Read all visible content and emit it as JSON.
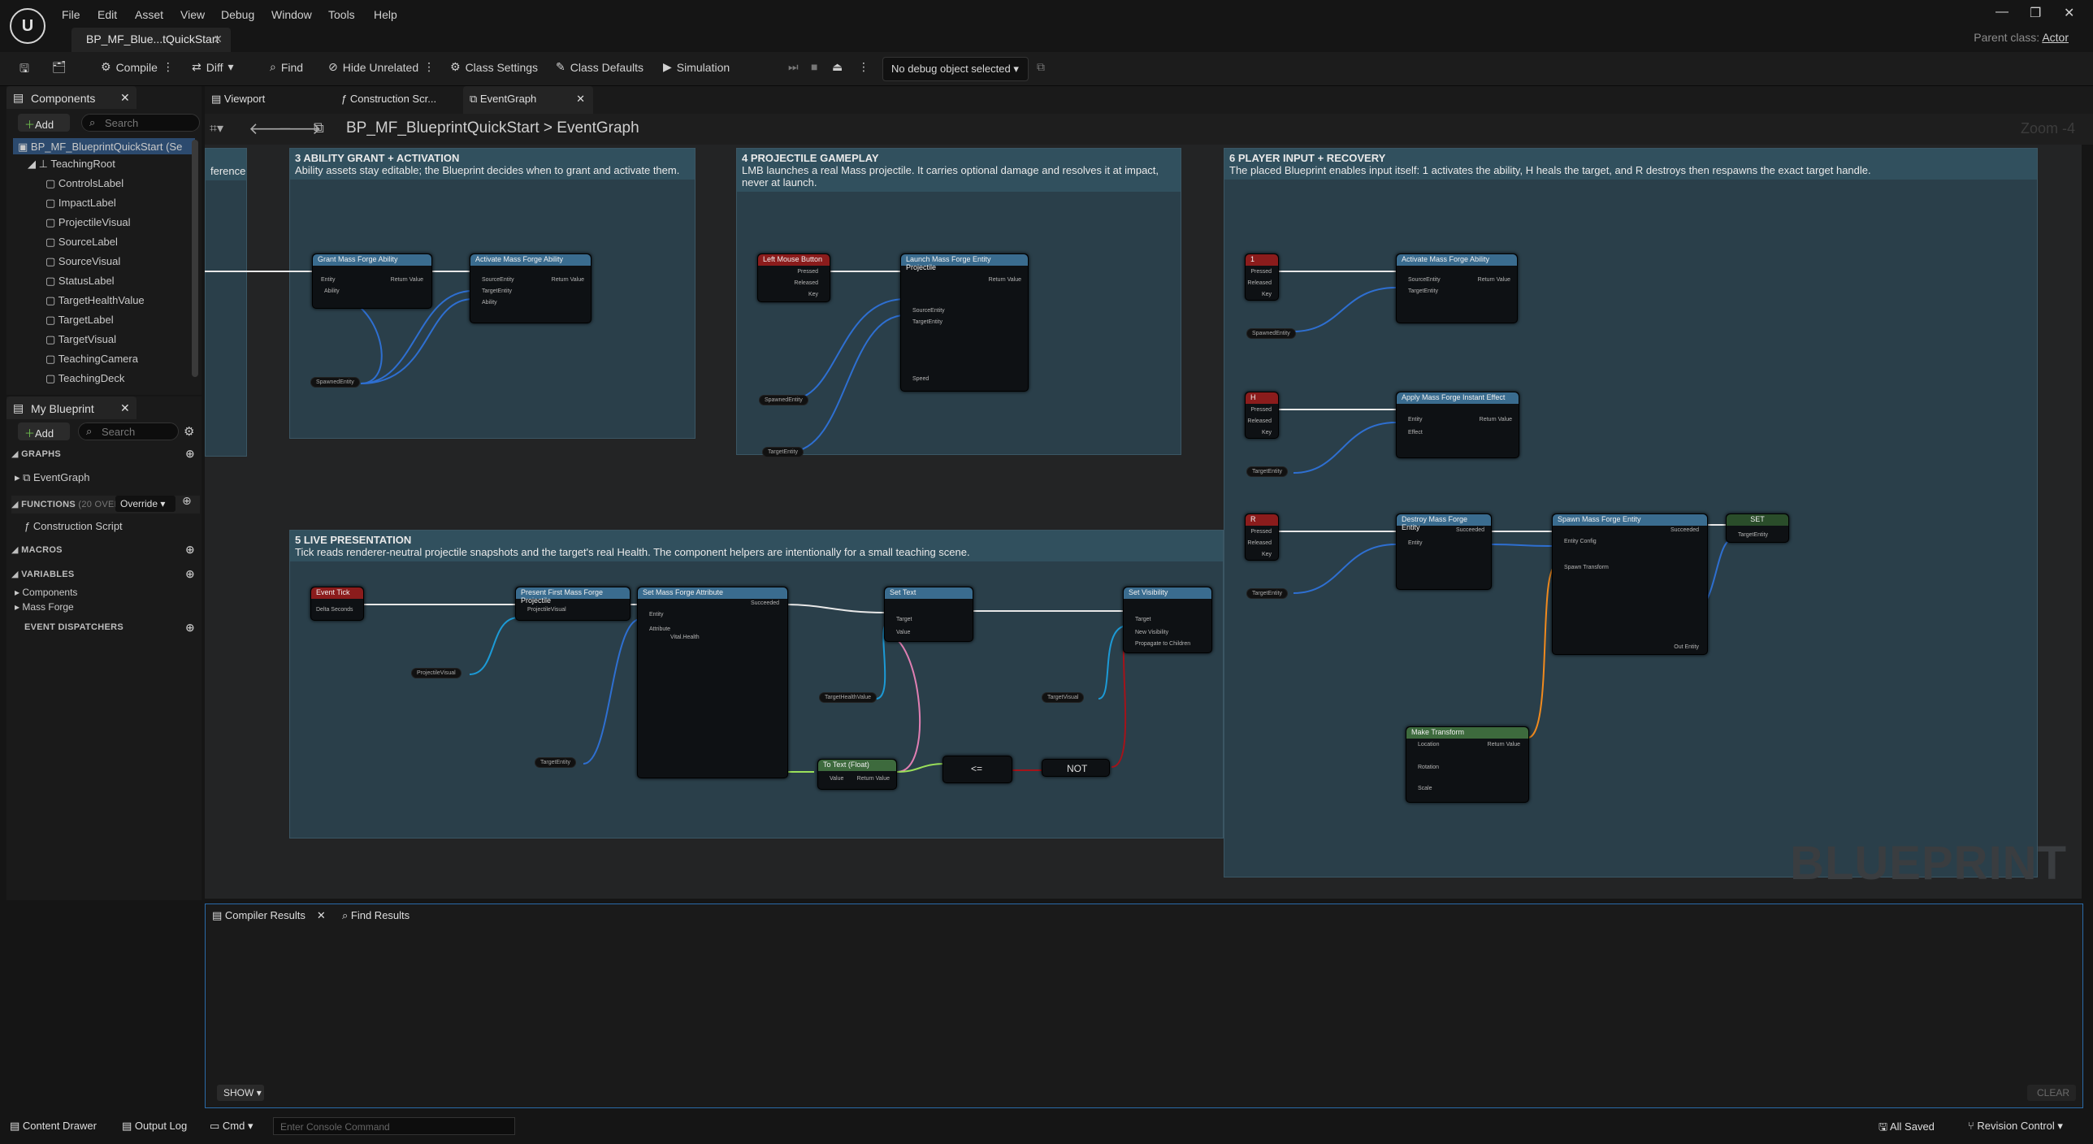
{
  "app": {
    "menu": [
      "File",
      "Edit",
      "Asset",
      "View",
      "Debug",
      "Window",
      "Tools",
      "Help"
    ],
    "doc_tab": "BP_MF_Blue...tQuickStart",
    "parent_class_label": "Parent class:",
    "parent_class_value": "Actor"
  },
  "toolbar": {
    "compile": "Compile",
    "diff": "Diff",
    "find": "Find",
    "hide_unrelated": "Hide Unrelated",
    "class_settings": "Class Settings",
    "class_defaults": "Class Defaults",
    "simulation": "Simulation",
    "debug_object": "No debug object selected"
  },
  "components": {
    "tab": "Components",
    "add": "Add",
    "search_placeholder": "Search",
    "root": "BP_MF_BlueprintQuickStart (Se",
    "scene_root": "TeachingRoot",
    "items": [
      "ControlsLabel",
      "ImpactLabel",
      "ProjectileVisual",
      "SourceLabel",
      "SourceVisual",
      "StatusLabel",
      "TargetHealthValue",
      "TargetLabel",
      "TargetVisual",
      "TeachingCamera",
      "TeachingDeck"
    ]
  },
  "my_blueprint": {
    "tab": "My Blueprint",
    "add": "Add",
    "search_placeholder": "Search",
    "graphs": "GRAPHS",
    "eventgraph": "EventGraph",
    "functions": "FUNCTIONS",
    "functions_count": "(20 OVER",
    "override": "Override",
    "construction_script": "Construction Script",
    "macros": "MACROS",
    "variables": "VARIABLES",
    "var_components": "Components",
    "var_massforge": "Mass Forge",
    "event_dispatchers": "EVENT DISPATCHERS"
  },
  "graph_tabs": [
    "Viewport",
    "Construction Scr...",
    "EventGraph"
  ],
  "breadcrumb": {
    "root": "BP_MF_BlueprintQuickStart",
    "sep": ">",
    "current": "EventGraph"
  },
  "zoom": "Zoom -4",
  "watermark": "BLUEPRINT",
  "comments": [
    {
      "title": "",
      "body": "ference"
    },
    {
      "title": "3 ABILITY GRANT + ACTIVATION",
      "body": "Ability assets stay editable; the Blueprint decides when to grant and activate them."
    },
    {
      "title": "4 PROJECTILE GAMEPLAY",
      "body": "LMB launches a real Mass projectile. It carries optional damage and resolves it at impact, never at launch."
    },
    {
      "title": "6 PLAYER INPUT + RECOVERY",
      "body": "The placed Blueprint enables input itself: 1 activates the ability, H heals the target, and R destroys then respawns the exact target handle."
    },
    {
      "title": "5 LIVE PRESENTATION",
      "body": "Tick reads renderer-neutral projectile snapshots and the target's real Health. The component helpers are intentionally for a small teaching scene."
    }
  ],
  "nodes": {
    "grant": "Grant Mass Forge Ability",
    "activate": "Activate Mass Forge Ability",
    "lmb": "Left Mouse Button",
    "launch": "Launch Mass Forge Entity Projectile",
    "key1": "1",
    "keyh": "H",
    "keyr": "R",
    "activate2": "Activate Mass Forge Ability",
    "apply": "Apply Mass Forge Instant Effect",
    "destroy": "Destroy Mass Forge Entity",
    "spawn": "Spawn Mass Forge Entity",
    "set": "SET",
    "tick": "Event Tick",
    "present": "Present First Mass Forge Projectile",
    "setattr": "Set Mass Forge Attribute",
    "settext": "Set Text",
    "setvis": "Set Visibility",
    "totext": "To Text (Float)",
    "not": "NOT",
    "maketransform": "Make Transform",
    "vars": {
      "spawned": "SpawnedEntity",
      "target": "TargetEntity",
      "projvisual": "ProjectileVisual",
      "thv": "TargetHealthValue",
      "tvisual": "TargetVisual"
    },
    "pins": {
      "pressed": "Pressed",
      "released": "Released",
      "key": "Key",
      "entity": "Entity",
      "ability": "Ability",
      "return": "Return Value",
      "source": "SourceEntity",
      "targetent": "TargetEntity",
      "effect": "Effect",
      "delta": "Delta Seconds",
      "target": "Target",
      "value": "Value",
      "newvis": "New Visibility",
      "propagate": "Propagate to Children",
      "health": "Vital.Health",
      "attribute": "Attribute",
      "location": "Location",
      "rotation": "Rotation",
      "scale": "Scale",
      "speed": "Speed",
      "spawnxf": "Spawn Transform",
      "entcfg": "Entity Config",
      "outent": "Out Entity",
      "succeeded": "Succeeded"
    }
  },
  "bottom": {
    "compiler_tab": "Compiler Results",
    "find_tab": "Find Results",
    "show": "SHOW",
    "clear": "CLEAR"
  },
  "status": {
    "content_drawer": "Content Drawer",
    "output_log": "Output Log",
    "cmd": "Cmd",
    "console_placeholder": "Enter Console Command",
    "all_saved": "All Saved",
    "revision_control": "Revision Control"
  }
}
